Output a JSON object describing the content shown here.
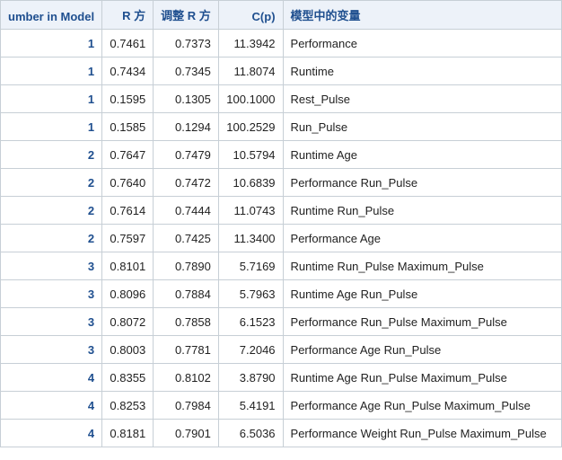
{
  "headers": {
    "num_in_model": "umber in Model",
    "rsq": "R 方",
    "adj_rsq": "调整 R 方",
    "cp": "C(p)",
    "vars": "模型中的变量"
  },
  "rows": [
    {
      "n": "1",
      "rsq": "0.7461",
      "adj": "0.7373",
      "cp": "11.3942",
      "vars": "Performance"
    },
    {
      "n": "1",
      "rsq": "0.7434",
      "adj": "0.7345",
      "cp": "11.8074",
      "vars": "Runtime"
    },
    {
      "n": "1",
      "rsq": "0.1595",
      "adj": "0.1305",
      "cp": "100.1000",
      "vars": "Rest_Pulse"
    },
    {
      "n": "1",
      "rsq": "0.1585",
      "adj": "0.1294",
      "cp": "100.2529",
      "vars": "Run_Pulse"
    },
    {
      "n": "2",
      "rsq": "0.7647",
      "adj": "0.7479",
      "cp": "10.5794",
      "vars": "Runtime Age"
    },
    {
      "n": "2",
      "rsq": "0.7640",
      "adj": "0.7472",
      "cp": "10.6839",
      "vars": "Performance Run_Pulse"
    },
    {
      "n": "2",
      "rsq": "0.7614",
      "adj": "0.7444",
      "cp": "11.0743",
      "vars": "Runtime Run_Pulse"
    },
    {
      "n": "2",
      "rsq": "0.7597",
      "adj": "0.7425",
      "cp": "11.3400",
      "vars": "Performance Age"
    },
    {
      "n": "3",
      "rsq": "0.8101",
      "adj": "0.7890",
      "cp": "5.7169",
      "vars": "Runtime Run_Pulse Maximum_Pulse"
    },
    {
      "n": "3",
      "rsq": "0.8096",
      "adj": "0.7884",
      "cp": "5.7963",
      "vars": "Runtime Age Run_Pulse"
    },
    {
      "n": "3",
      "rsq": "0.8072",
      "adj": "0.7858",
      "cp": "6.1523",
      "vars": "Performance Run_Pulse Maximum_Pulse"
    },
    {
      "n": "3",
      "rsq": "0.8003",
      "adj": "0.7781",
      "cp": "7.2046",
      "vars": "Performance Age Run_Pulse"
    },
    {
      "n": "4",
      "rsq": "0.8355",
      "adj": "0.8102",
      "cp": "3.8790",
      "vars": "Runtime Age Run_Pulse Maximum_Pulse"
    },
    {
      "n": "4",
      "rsq": "0.8253",
      "adj": "0.7984",
      "cp": "5.4191",
      "vars": "Performance Age Run_Pulse Maximum_Pulse"
    },
    {
      "n": "4",
      "rsq": "0.8181",
      "adj": "0.7901",
      "cp": "6.5036",
      "vars": "Performance Weight Run_Pulse Maximum_Pulse"
    }
  ]
}
